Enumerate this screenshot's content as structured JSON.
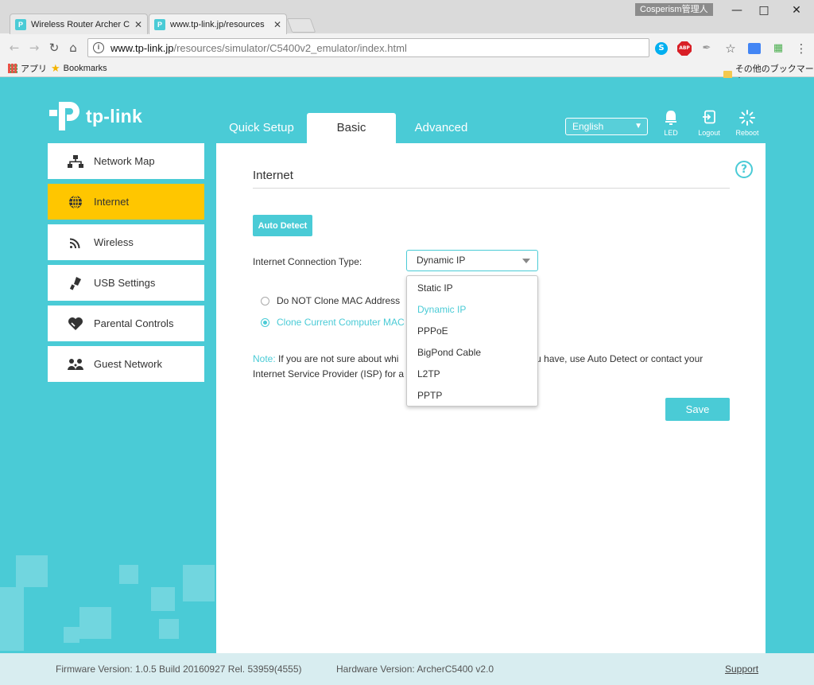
{
  "browser": {
    "tabs": [
      {
        "title": "Wireless Router Archer C",
        "active": false
      },
      {
        "title": "www.tp-link.jp/resources",
        "active": true
      }
    ],
    "profile": "Cosperism管理人",
    "url_host": "www.tp-link.jp",
    "url_path": "/resources/simulator/C5400v2_emulator/index.html",
    "bookmarks": {
      "apps": "アプリ",
      "bookmarks": "Bookmarks",
      "other": "その他のブックマーク"
    },
    "extensions": {
      "abp": "ABP"
    }
  },
  "router": {
    "logo": "tp-link",
    "nav_tabs": [
      "Quick Setup",
      "Basic",
      "Advanced"
    ],
    "active_tab": "Basic",
    "language": "English",
    "top_icons": {
      "led": "LED",
      "logout": "Logout",
      "reboot": "Reboot"
    },
    "sidebar": [
      {
        "label": "Network Map",
        "icon": "network-map-icon"
      },
      {
        "label": "Internet",
        "icon": "globe-icon",
        "active": true
      },
      {
        "label": "Wireless",
        "icon": "wifi-icon"
      },
      {
        "label": "USB Settings",
        "icon": "usb-icon"
      },
      {
        "label": "Parental Controls",
        "icon": "heart-icon"
      },
      {
        "label": "Guest Network",
        "icon": "guest-icon"
      }
    ],
    "section_title": "Internet",
    "auto_detect": "Auto Detect",
    "connection_label": "Internet Connection Type:",
    "connection_value": "Dynamic IP",
    "connection_options": [
      "Static IP",
      "Dynamic IP",
      "PPPoE",
      "BigPond Cable",
      "L2TP",
      "PPTP"
    ],
    "mac_options": [
      {
        "label": "Do NOT Clone MAC Address",
        "checked": false
      },
      {
        "label": "Clone Current Computer MAC A",
        "checked": true
      }
    ],
    "note_lead": "Note:",
    "note_line1_a": "If you are not sure about whi",
    "note_line1_b": "ou have, use Auto Detect or contact your",
    "note_line2": "Internet Service Provider (ISP) for a",
    "save": "Save",
    "footer": {
      "firmware": "Firmware Version: 1.0.5 Build 20160927 Rel. 53959(4555)",
      "hardware": "Hardware Version: ArcherC5400 v2.0",
      "support": "Support"
    },
    "accent_color": "#4acbd6",
    "active_color": "#ffc600"
  }
}
